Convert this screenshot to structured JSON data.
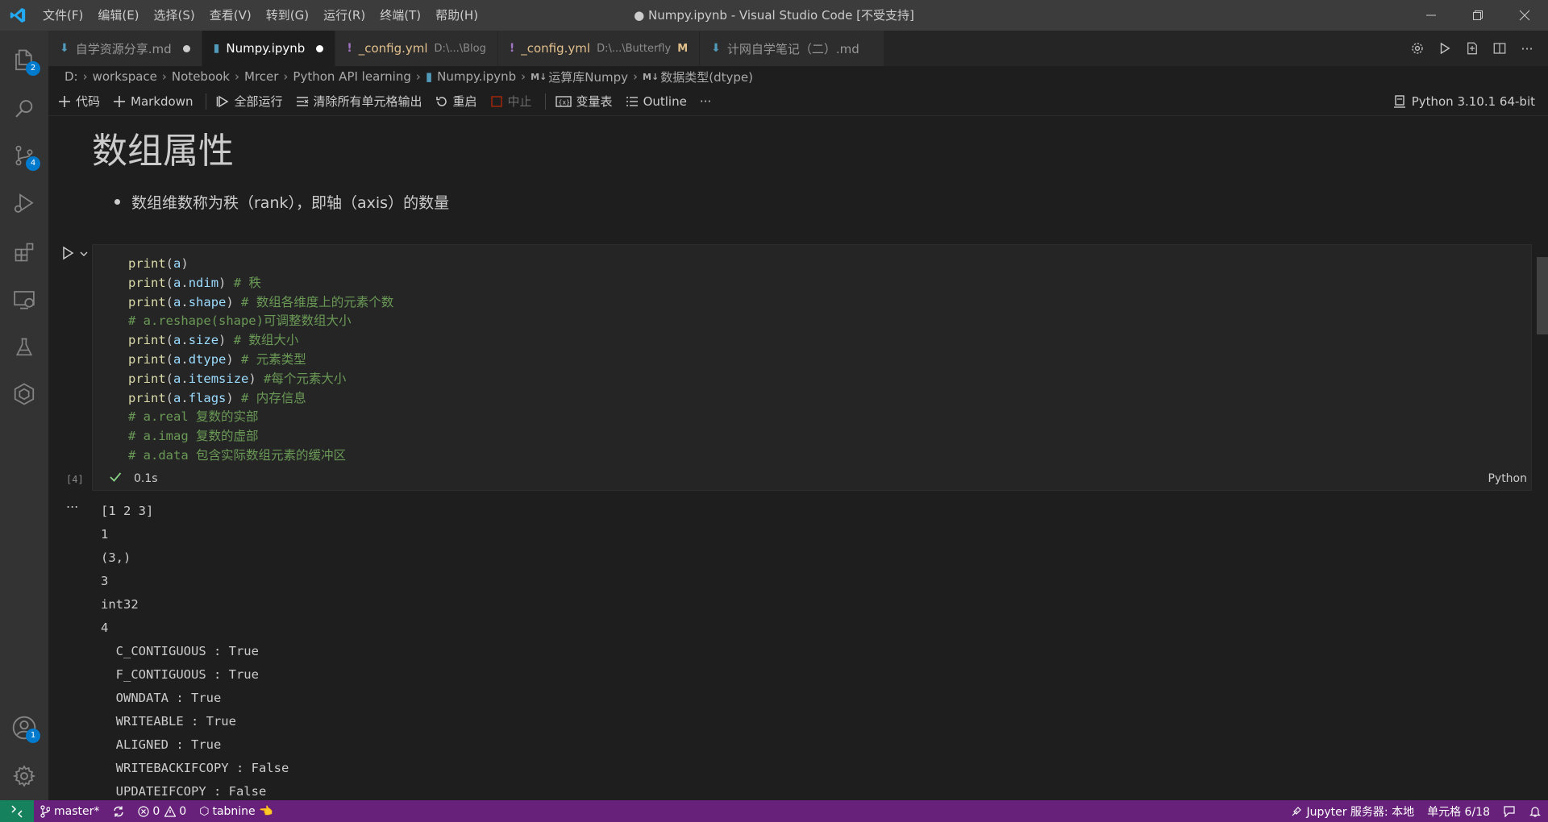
{
  "titlebar": {
    "title": "● Numpy.ipynb - Visual Studio Code [不受支持]",
    "menu": [
      "文件(F)",
      "编辑(E)",
      "选择(S)",
      "查看(V)",
      "转到(G)",
      "运行(R)",
      "终端(T)",
      "帮助(H)"
    ]
  },
  "activitybar": {
    "explorer_badge": "2",
    "scm_badge": "4",
    "accounts_badge": "1"
  },
  "tabs": [
    {
      "icon": "markdown-icon",
      "name": "自学资源分享.md",
      "desc": "",
      "state": "dirty",
      "active": false
    },
    {
      "icon": "notebook-icon",
      "name": "Numpy.ipynb",
      "desc": "",
      "state": "dirty",
      "active": true
    },
    {
      "icon": "yaml-icon",
      "name": "_config.yml",
      "desc": "D:\\...\\Blog",
      "state": "",
      "active": false
    },
    {
      "icon": "yaml-icon",
      "name": "_config.yml",
      "desc": "D:\\...\\Butterfly",
      "state": "M",
      "active": false
    },
    {
      "icon": "markdown-icon",
      "name": "计网自学笔记（二）.md",
      "desc": "",
      "state": "",
      "active": false
    }
  ],
  "breadcrumb": [
    "D:",
    "workspace",
    "Notebook",
    "Mrcer",
    "Python API learning",
    "Numpy.ipynb",
    "运算库Numpy",
    "数据类型(dtype)"
  ],
  "toolbar": {
    "add_code": "代码",
    "add_markdown": "Markdown",
    "run_all": "全部运行",
    "clear_outputs": "清除所有单元格输出",
    "restart": "重启",
    "interrupt": "中止",
    "variables": "变量表",
    "outline": "Outline",
    "more": "···",
    "kernel": "Python 3.10.1 64-bit"
  },
  "markdown": {
    "heading": "数组属性",
    "bullet": "数组维数称为秩（rank），即轴（axis）的数量"
  },
  "code_cell": {
    "lines": [
      [
        {
          "t": "print",
          "c": "c-fn"
        },
        {
          "t": "(",
          "c": "c-pun"
        },
        {
          "t": "a",
          "c": "c-var"
        },
        {
          "t": ")",
          "c": "c-pun"
        }
      ],
      [
        {
          "t": "print",
          "c": "c-fn"
        },
        {
          "t": "(",
          "c": "c-pun"
        },
        {
          "t": "a",
          "c": "c-var"
        },
        {
          "t": ".",
          "c": "c-pun"
        },
        {
          "t": "ndim",
          "c": "c-var"
        },
        {
          "t": ") ",
          "c": "c-pun"
        },
        {
          "t": "# 秩",
          "c": "c-cm"
        }
      ],
      [
        {
          "t": "print",
          "c": "c-fn"
        },
        {
          "t": "(",
          "c": "c-pun"
        },
        {
          "t": "a",
          "c": "c-var"
        },
        {
          "t": ".",
          "c": "c-pun"
        },
        {
          "t": "shape",
          "c": "c-var"
        },
        {
          "t": ") ",
          "c": "c-pun"
        },
        {
          "t": "# 数组各维度上的元素个数",
          "c": "c-cm"
        }
      ],
      [
        {
          "t": "# a.reshape(shape)可调整数组大小",
          "c": "c-cm"
        }
      ],
      [
        {
          "t": "print",
          "c": "c-fn"
        },
        {
          "t": "(",
          "c": "c-pun"
        },
        {
          "t": "a",
          "c": "c-var"
        },
        {
          "t": ".",
          "c": "c-pun"
        },
        {
          "t": "size",
          "c": "c-var"
        },
        {
          "t": ") ",
          "c": "c-pun"
        },
        {
          "t": "# 数组大小",
          "c": "c-cm"
        }
      ],
      [
        {
          "t": "print",
          "c": "c-fn"
        },
        {
          "t": "(",
          "c": "c-pun"
        },
        {
          "t": "a",
          "c": "c-var"
        },
        {
          "t": ".",
          "c": "c-pun"
        },
        {
          "t": "dtype",
          "c": "c-var"
        },
        {
          "t": ") ",
          "c": "c-pun"
        },
        {
          "t": "# 元素类型",
          "c": "c-cm"
        }
      ],
      [
        {
          "t": "print",
          "c": "c-fn"
        },
        {
          "t": "(",
          "c": "c-pun"
        },
        {
          "t": "a",
          "c": "c-var"
        },
        {
          "t": ".",
          "c": "c-pun"
        },
        {
          "t": "itemsize",
          "c": "c-var"
        },
        {
          "t": ") ",
          "c": "c-pun"
        },
        {
          "t": "#每个元素大小",
          "c": "c-cm"
        }
      ],
      [
        {
          "t": "print",
          "c": "c-fn"
        },
        {
          "t": "(",
          "c": "c-pun"
        },
        {
          "t": "a",
          "c": "c-var"
        },
        {
          "t": ".",
          "c": "c-pun"
        },
        {
          "t": "flags",
          "c": "c-var"
        },
        {
          "t": ") ",
          "c": "c-pun"
        },
        {
          "t": "# 内存信息",
          "c": "c-cm"
        }
      ],
      [
        {
          "t": "# a.real 复数的实部",
          "c": "c-cm"
        }
      ],
      [
        {
          "t": "# a.imag 复数的虚部",
          "c": "c-cm"
        }
      ],
      [
        {
          "t": "# a.data 包含实际数组元素的缓冲区",
          "c": "c-cm"
        }
      ]
    ],
    "execution_count": "[4]",
    "duration": "0.1s",
    "language": "Python"
  },
  "output": {
    "more": "...",
    "lines": [
      "[1 2 3]",
      "1",
      "(3,)",
      "3",
      "int32",
      "4",
      "  C_CONTIGUOUS : True",
      "  F_CONTIGUOUS : True",
      "  OWNDATA : True",
      "  WRITEABLE : True",
      "  ALIGNED : True",
      "  WRITEBACKIFCOPY : False",
      "  UPDATEIFCOPY : False"
    ]
  },
  "statusbar": {
    "branch": "master*",
    "errors": "0",
    "warnings": "0",
    "tabnine": "tabnine 👈",
    "jupyter": "Jupyter 服务器: 本地",
    "cell": "单元格 6/18"
  },
  "colors": {
    "titlebar": "#3c3c3c",
    "activitybar": "#333333",
    "editor": "#1e1e1e",
    "statusbar": "#68217a",
    "remote": "#16825d",
    "badge": "#007acc"
  }
}
